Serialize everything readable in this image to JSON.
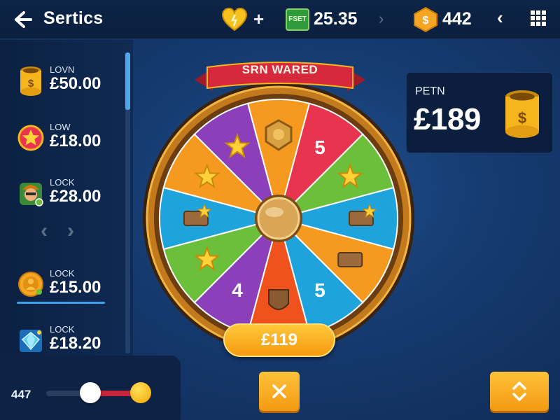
{
  "header": {
    "title": "Sertics",
    "plus": "+",
    "cash_icon_text": "FSET",
    "cash_value": "25.35",
    "coin_value": "442",
    "icons": [
      "back-arrow-icon",
      "heart-icon",
      "cash-icon",
      "chevron-right-icon",
      "coin-icon",
      "chevron-left-icon",
      "grid-menu-icon"
    ]
  },
  "prizes": [
    {
      "label": "LOVN",
      "amount": "£50.00",
      "icon": "gold-pot-icon"
    },
    {
      "label": "LOW",
      "amount": "£18.00",
      "icon": "star-badge-icon"
    },
    {
      "label": "LOCK",
      "amount": "£28.00",
      "icon": "character-icon"
    },
    {
      "label": "LOCK",
      "amount": "£15.00",
      "icon": "gold-coin-icon"
    },
    {
      "label": "LOCK",
      "amount": "£18.20",
      "icon": "diamond-icon"
    }
  ],
  "pager": {
    "prev": "‹",
    "next": "›"
  },
  "slider": {
    "value": "447",
    "level": 0.45,
    "colors": {
      "track": "#2a3f60",
      "fill": "#c4253a",
      "gold": "#f2a600"
    }
  },
  "wheel": {
    "banner": "SRN WARED",
    "pill": "£119",
    "segments": [
      {
        "color": "#f59a1e",
        "content": "badge"
      },
      {
        "color": "#e8344f",
        "content": "5"
      },
      {
        "color": "#6cbf3a",
        "content": "star"
      },
      {
        "color": "#1fa3dc",
        "content": "ticket-star"
      },
      {
        "color": "#f59a1e",
        "content": "ticket"
      },
      {
        "color": "#1fa3dc",
        "content": "5"
      },
      {
        "color": "#f0521e",
        "content": "shield"
      },
      {
        "color": "#8b3fb8",
        "content": "4"
      },
      {
        "color": "#6cbf3a",
        "content": "star"
      },
      {
        "color": "#1fa3dc",
        "content": "ticket-star"
      },
      {
        "color": "#f59a1e",
        "content": "star"
      },
      {
        "color": "#8b3fb8",
        "content": "star"
      }
    ]
  },
  "reward": {
    "label": "PETN",
    "amount": "£189",
    "icon": "gold-pot-icon"
  },
  "buttons": {
    "close": "close-icon",
    "swap": "swap-arrows-icon"
  },
  "colors": {
    "accent": "#3ba3ee",
    "gold": "#f59a10",
    "bg": "#153a6e"
  }
}
